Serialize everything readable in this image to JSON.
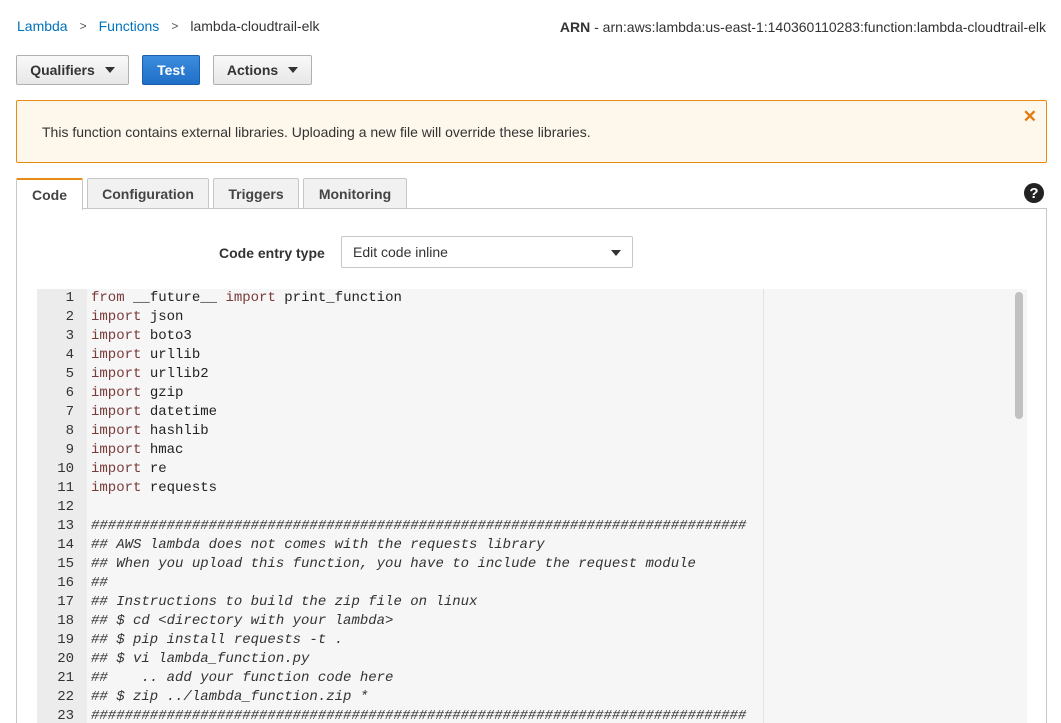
{
  "breadcrumb": {
    "items": [
      "Lambda",
      "Functions"
    ],
    "separator": ">",
    "current": "lambda-cloudtrail-elk"
  },
  "arn": {
    "label": "ARN",
    "value": "- arn:aws:lambda:us-east-1:140360110283:function:lambda-cloudtrail-elk"
  },
  "toolbar": {
    "qualifiers_label": "Qualifiers",
    "test_label": "Test",
    "actions_label": "Actions"
  },
  "alert": {
    "message": "This function contains external libraries. Uploading a new file will override these libraries.",
    "close_icon": "close-icon",
    "color": "#e88b15"
  },
  "tabs": [
    "Code",
    "Configuration",
    "Triggers",
    "Monitoring"
  ],
  "help": {
    "icon": "help-icon",
    "glyph": "?"
  },
  "code_entry": {
    "label": "Code entry type",
    "value": "Edit code inline"
  },
  "editor": {
    "lines": [
      {
        "n": "1",
        "kw": "from",
        "rest": " __future__ ",
        "kw2": "import",
        "rest2": " print_function"
      },
      {
        "n": "2",
        "kw": "import",
        "rest": " json"
      },
      {
        "n": "3",
        "kw": "import",
        "rest": " boto3"
      },
      {
        "n": "4",
        "kw": "import",
        "rest": " urllib"
      },
      {
        "n": "5",
        "kw": "import",
        "rest": " urllib2"
      },
      {
        "n": "6",
        "kw": "import",
        "rest": " gzip"
      },
      {
        "n": "7",
        "kw": "import",
        "rest": " datetime"
      },
      {
        "n": "8",
        "kw": "import",
        "rest": " hashlib"
      },
      {
        "n": "9",
        "kw": "import",
        "rest": " hmac"
      },
      {
        "n": "10",
        "kw": "import",
        "rest": " re"
      },
      {
        "n": "11",
        "kw": "import",
        "rest": " requests"
      },
      {
        "n": "12",
        "comment": ""
      },
      {
        "n": "13",
        "comment": "##############################################################################"
      },
      {
        "n": "14",
        "comment": "## AWS lambda does not comes with the requests library"
      },
      {
        "n": "15",
        "comment": "## When you upload this function, you have to include the request module"
      },
      {
        "n": "16",
        "comment": "##"
      },
      {
        "n": "17",
        "comment": "## Instructions to build the zip file on linux"
      },
      {
        "n": "18",
        "comment": "## $ cd <directory with your lambda>"
      },
      {
        "n": "19",
        "comment": "## $ pip install requests -t ."
      },
      {
        "n": "20",
        "comment": "## $ vi lambda_function.py"
      },
      {
        "n": "21",
        "comment": "##    .. add your function code here"
      },
      {
        "n": "22",
        "comment": "## $ zip ../lambda_function.zip *"
      },
      {
        "n": "23",
        "comment": "##############################################################################"
      }
    ]
  }
}
